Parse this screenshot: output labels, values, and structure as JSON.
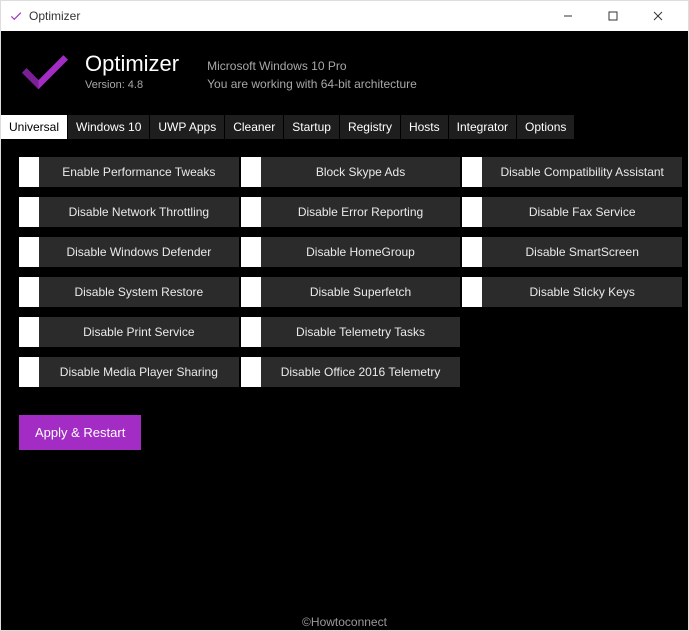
{
  "window": {
    "title": "Optimizer"
  },
  "header": {
    "title": "Optimizer",
    "version": "Version: 4.8",
    "os": "Microsoft Windows 10 Pro",
    "arch": "You are working with 64-bit architecture"
  },
  "tabs": [
    "Universal",
    "Windows 10",
    "UWP Apps",
    "Cleaner",
    "Startup",
    "Registry",
    "Hosts",
    "Integrator",
    "Options"
  ],
  "columns": [
    [
      "Enable Performance Tweaks",
      "Disable Network Throttling",
      "Disable Windows Defender",
      "Disable System Restore",
      "Disable Print Service",
      "Disable Media Player Sharing"
    ],
    [
      "Block Skype Ads",
      "Disable Error Reporting",
      "Disable HomeGroup",
      "Disable Superfetch",
      "Disable Telemetry Tasks",
      "Disable Office 2016 Telemetry"
    ],
    [
      "Disable Compatibility Assistant",
      "Disable Fax Service",
      "Disable SmartScreen",
      "Disable Sticky Keys"
    ]
  ],
  "apply": "Apply & Restart",
  "watermark": "©Howtoconnect",
  "accent": "#a32cc4"
}
